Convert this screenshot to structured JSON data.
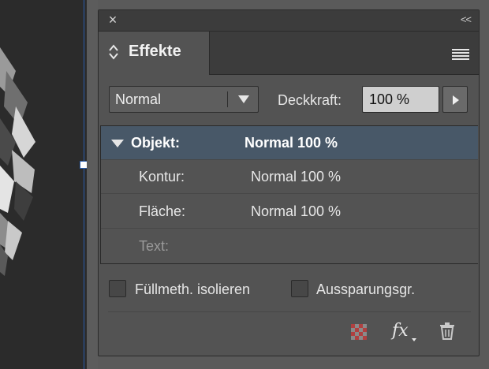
{
  "panel": {
    "close_icon": "close-icon",
    "collapse_icon": "double-chevron-icon",
    "tab_label": "Effekte",
    "menu_icon": "panel-menu-icon"
  },
  "controls": {
    "blend_mode": "Normal",
    "opacity_label": "Deckkraft:",
    "opacity_value": "100 %"
  },
  "list": {
    "rows": [
      {
        "label": "Objekt:",
        "value": "Normal 100 %"
      },
      {
        "label": "Kontur:",
        "value": "Normal 100 %"
      },
      {
        "label": "Fläche:",
        "value": "Normal 100 %"
      },
      {
        "label": "Text:",
        "value": ""
      }
    ]
  },
  "options": {
    "isolate_blending_label": "Füllmeth. isolieren",
    "knockout_group_label": "Aussparungsgr."
  },
  "tools": {
    "clear_icon": "clear-effects-icon",
    "fx_label": "fx",
    "trash_icon": "trash-icon"
  },
  "colors": {
    "panel_bg": "#535353",
    "selected_row": "#485868",
    "selection_blue": "#2a5caa"
  }
}
